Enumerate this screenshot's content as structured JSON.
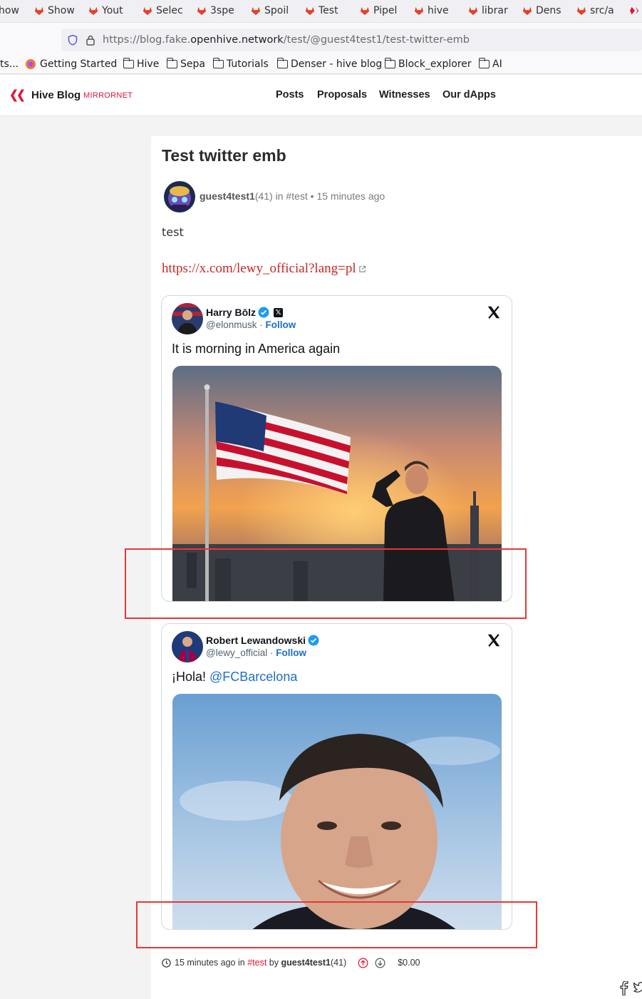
{
  "browser": {
    "tabs": [
      {
        "title": "how",
        "icon": "gitlab-icon"
      },
      {
        "title": "Show",
        "icon": "gitlab-icon"
      },
      {
        "title": "Yout",
        "icon": "gitlab-icon"
      },
      {
        "title": "Selec",
        "icon": "gitlab-icon"
      },
      {
        "title": "3spe",
        "icon": "gitlab-icon"
      },
      {
        "title": "Spoil",
        "icon": "gitlab-icon"
      },
      {
        "title": "Test",
        "icon": "gitlab-icon"
      },
      {
        "title": "Pipel",
        "icon": "gitlab-icon"
      },
      {
        "title": "hive",
        "icon": "gitlab-icon"
      },
      {
        "title": "librar",
        "icon": "gitlab-icon"
      },
      {
        "title": "Dens",
        "icon": "gitlab-icon"
      },
      {
        "title": "src/a",
        "icon": "gitlab-icon"
      }
    ],
    "url_prefix": "https://blog.fake.",
    "url_domain": "openhive.network",
    "url_path": "/test/@guest4test1/test-twitter-emb",
    "bookmarks": {
      "overflow": "ts...",
      "getting_started": "Getting Started",
      "folders": [
        "Hive",
        "Sepa",
        "Tutorials",
        "Denser - hive blog",
        "Block_explorer",
        "AI"
      ]
    }
  },
  "site": {
    "brand": "Hive Blog",
    "brand_sub": "MIRRORNET",
    "nav": [
      "Posts",
      "Proposals",
      "Witnesses",
      "Our dApps"
    ],
    "accent": "#e31337"
  },
  "post": {
    "title": "Test twitter emb",
    "author": "guest4test1",
    "reputation": "(41)",
    "in_word": "in",
    "category": "#test",
    "time": "• 15 minutes ago",
    "body": "test",
    "link": "https://x.com/lewy_official?lang=pl"
  },
  "tweets": [
    {
      "name": "Harry Bōlz",
      "handle": "@elonmusk",
      "follow": "Follow",
      "text": "It is morning in America again",
      "mention": ""
    },
    {
      "name": "Robert Lewandowski",
      "handle": "@lewy_official",
      "follow": "Follow",
      "text": "¡Hola! ",
      "mention": "@FCBarcelona"
    }
  ],
  "footer": {
    "time": "15 minutes ago",
    "in_word": "in",
    "tag": "#test",
    "by_word": "by",
    "author": "guest4test1",
    "reputation": "(41)",
    "payout": "$0.00"
  }
}
